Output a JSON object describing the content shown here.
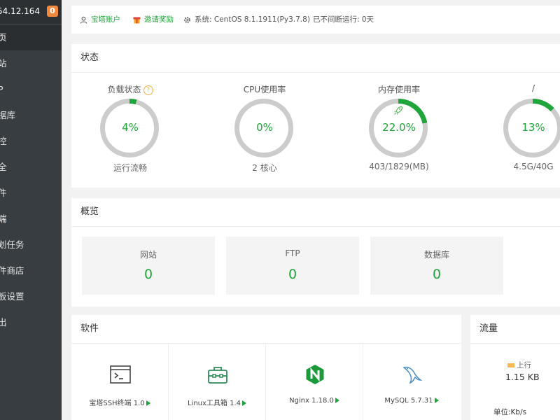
{
  "sidebar": {
    "ip": "54.12.164",
    "badge": "0",
    "items": [
      {
        "label": "页"
      },
      {
        "label": "站"
      },
      {
        "label": "P"
      },
      {
        "label": "据库"
      },
      {
        "label": "控"
      },
      {
        "label": "全"
      },
      {
        "label": "件"
      },
      {
        "label": "端"
      },
      {
        "label": "划任务"
      },
      {
        "label": "件商店"
      },
      {
        "label": "板设置"
      },
      {
        "label": "出"
      }
    ]
  },
  "topbar": {
    "account": "宝塔账户",
    "invite": "邀请奖励",
    "system": "系统:  CentOS 8.1.1911(Py3.7.8)",
    "uptime": "已不间断运行: 0天"
  },
  "status": {
    "title": "状态",
    "gauges": [
      {
        "label": "负载状态",
        "value": "4%",
        "percent": 4,
        "sub": "运行流畅",
        "help": "?"
      },
      {
        "label": "CPU使用率",
        "value": "0%",
        "percent": 0,
        "sub": "2 核心"
      },
      {
        "label": "内存使用率",
        "value": "22.0%",
        "percent": 22,
        "sub": "403/1829(MB)"
      },
      {
        "label": "/",
        "value": "13%",
        "percent": 13,
        "sub": "4.5G/40G"
      }
    ]
  },
  "overview": {
    "title": "概览",
    "items": [
      {
        "label": "网站",
        "value": "0"
      },
      {
        "label": "FTP",
        "value": "0"
      },
      {
        "label": "数据库",
        "value": "0"
      }
    ]
  },
  "software": {
    "title": "软件",
    "items": [
      {
        "label": "宝塔SSH终端 1.0",
        "icon": "terminal-icon"
      },
      {
        "label": "Linux工具箱 1.4",
        "icon": "toolbox-icon"
      },
      {
        "label": "Nginx 1.18.0",
        "icon": "nginx-icon"
      },
      {
        "label": "MySQL 5.7.31",
        "icon": "mysql-dolphin-icon"
      }
    ]
  },
  "traffic": {
    "title": "流量",
    "up_label": "上行",
    "up_value": "1.15 KB",
    "unit": "单位:Kb/s"
  },
  "colors": {
    "accent": "#20a53a",
    "sidebar_bg": "#383d41",
    "ring_bg": "#cccccc",
    "badge": "#f0883e"
  }
}
